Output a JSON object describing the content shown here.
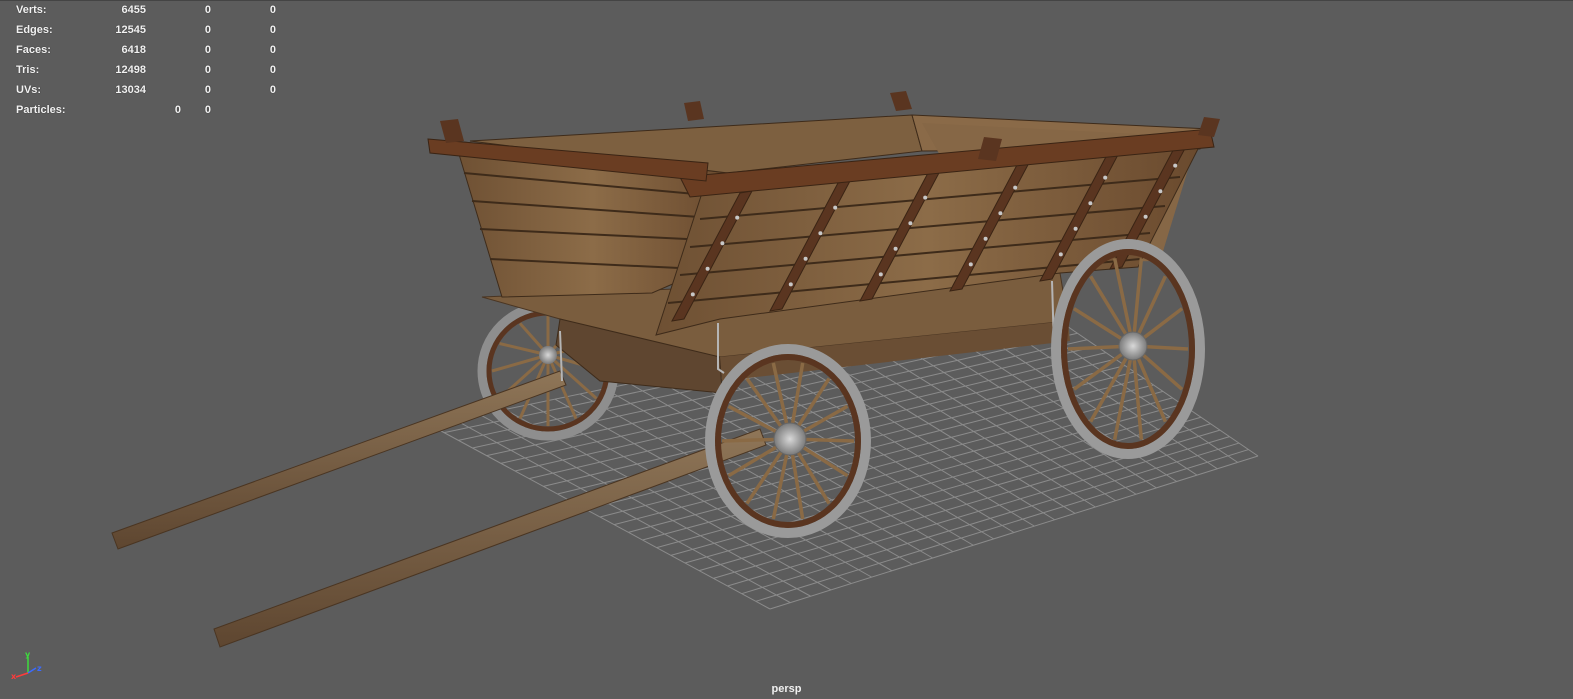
{
  "hud": {
    "rows": [
      {
        "label": "Verts:",
        "v1": "6455",
        "v2": "0",
        "v3": "0"
      },
      {
        "label": "Edges:",
        "v1": "12545",
        "v2": "0",
        "v3": "0"
      },
      {
        "label": "Faces:",
        "v1": "6418",
        "v2": "0",
        "v3": "0"
      },
      {
        "label": "Tris:",
        "v1": "12498",
        "v2": "0",
        "v3": "0"
      },
      {
        "label": "UVs:",
        "v1": "13034",
        "v2": "0",
        "v3": "0"
      }
    ],
    "particles": {
      "label": "Particles:",
      "v1": "0",
      "v2": "0"
    }
  },
  "camera": {
    "name": "persp"
  },
  "axis_gizmo": {
    "x": "x",
    "y": "y",
    "z": "z"
  },
  "colors": {
    "viewport_bg": "#5c5c5c",
    "grid": "#8a8a8a",
    "wood_dark": "#5a3520",
    "wood_light": "#8a6a45",
    "iron": "#9a9a9a"
  }
}
